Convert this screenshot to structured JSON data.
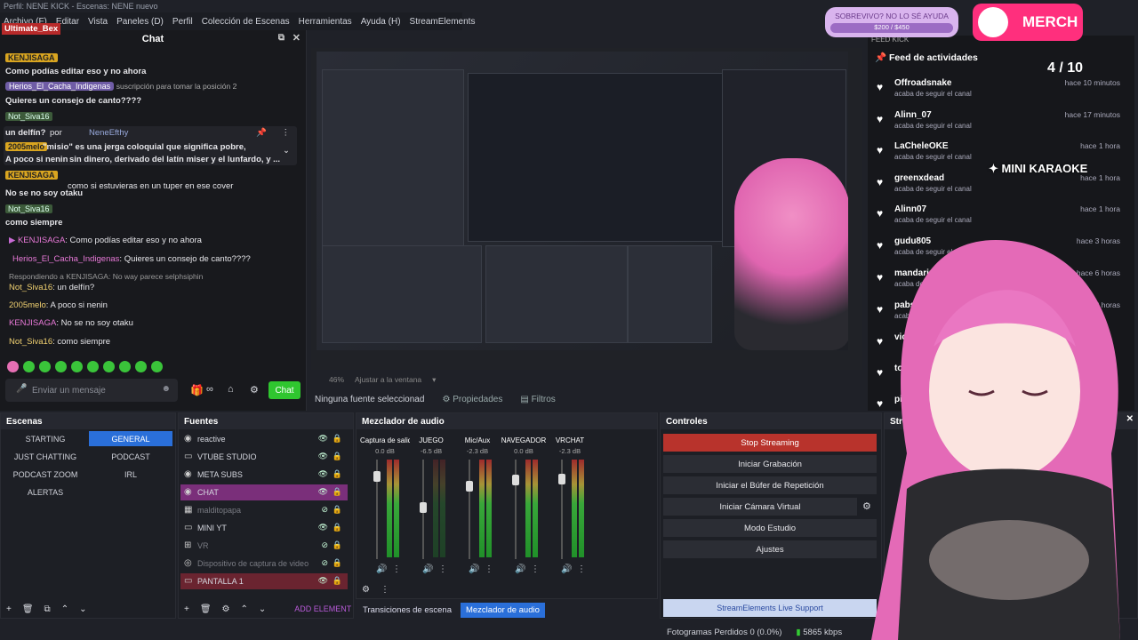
{
  "window": {
    "title": "Perfil: NENE KICK - Escenas: NENE nuevo"
  },
  "menu": [
    "Archivo (F)",
    "Editar",
    "Vista",
    "Paneles (D)",
    "Perfil",
    "Colección de Escenas",
    "Herramientas",
    "Ayuda (H)",
    "StreamElements"
  ],
  "chat": {
    "title": "Chat",
    "overlay_user": "Ultimate_Bex",
    "pinned_by_label": "un delfín?",
    "pinned_by": "por",
    "pinned_user": "NeneEfthy",
    "sub_note": "suscripción para tomar la posición 2",
    "lines": [
      {
        "user": "KENJISAGA",
        "text": "Como podías editar eso y no ahora"
      },
      {
        "user": "Herios_El_Cacha_Indigenas",
        "text": "Quieres un consejo de canto????"
      },
      {
        "user": "Not_Siva16",
        "text": ""
      },
      {
        "user": "2005melo",
        "text": "\"misio\" es una jerga coloquial que significa pobre,"
      },
      {
        "user": "",
        "text": "A poco si nenin"
      },
      {
        "user": "",
        "text": "sin dinero, derivado del latín miser y el lunfardo, y ..."
      },
      {
        "user": "KENJISAGA",
        "text": "como si estuvieras en un tuper en ese cover"
      },
      {
        "user": "",
        "text": "No se no soy otaku"
      },
      {
        "user": "Not_Siva16",
        "text": "como siempre"
      }
    ],
    "recent": [
      {
        "user": "KENJISAGA",
        "text": ": Como podías editar eso y no ahora"
      },
      {
        "user": "Herios_El_Cacha_Indigenas",
        "text": ": Quieres un consejo de canto????"
      },
      {
        "user": "",
        "text": "Respondiendo a KENJISAGA: No way parece selphsiphin"
      },
      {
        "user": "Not_Siva16",
        "text": ": un delfín?"
      },
      {
        "user": "2005melo",
        "text": ": A poco si nenin"
      },
      {
        "user": "KENJISAGA",
        "text": ": No se no soy otaku"
      },
      {
        "user": "Not_Siva16",
        "text": ": como siempre"
      }
    ],
    "input_placeholder": "Enviar un mensaje",
    "send_label": "Chat"
  },
  "preview": {
    "zoom": "46%",
    "fit_label": "Ajustar a la ventana"
  },
  "source_bar": {
    "none": "Ninguna fuente seleccionad",
    "properties": "Propiedades",
    "filters": "Filtros"
  },
  "feed": {
    "dock_title": "FEED KICK",
    "title": "Feed de actividades",
    "items": [
      {
        "name": "Offroadsnake",
        "action": "acaba de seguir el canal",
        "time": "hace 10 minutos"
      },
      {
        "name": "Alinn_07",
        "action": "acaba de seguir el canal",
        "time": "hace 17 minutos"
      },
      {
        "name": "LaCheleOKE",
        "action": "acaba de seguir el canal",
        "time": "hace 1 hora"
      },
      {
        "name": "greenxdead",
        "action": "acaba de seguir el canal",
        "time": "hace 1 hora"
      },
      {
        "name": "Alinn07",
        "action": "acaba de seguir el canal",
        "time": "hace 1 hora"
      },
      {
        "name": "gudu805",
        "action": "acaba de seguir el canal",
        "time": "hace 3 horas"
      },
      {
        "name": "mandarinat",
        "action": "acaba de seguir el canal",
        "time": "hace 6 horas"
      },
      {
        "name": "pabs75",
        "action": "acaba de seguir el canal",
        "time": "12 horas"
      },
      {
        "name": "victoroski",
        "action": "",
        "time": ""
      },
      {
        "name": "tomitoki",
        "action": "",
        "time": ""
      },
      {
        "name": "pierntony",
        "action": "",
        "time": ""
      }
    ]
  },
  "overlay": {
    "merch": "MERCH",
    "goal_text": "SOBREVIVO? NO LO SÉ AYUDA",
    "goal_amount": "$200 / $450",
    "counter": "4 / 10",
    "karaoke": "✦ MINI KARAOKE"
  },
  "scenes": {
    "title": "Escenas",
    "items": [
      {
        "label": "STARTING",
        "selected": false
      },
      {
        "label": "GENERAL",
        "selected": true
      },
      {
        "label": "JUST CHATTING",
        "selected": false
      },
      {
        "label": "PODCAST",
        "selected": false
      },
      {
        "label": "PODCAST ZOOM",
        "selected": false
      },
      {
        "label": "IRL",
        "selected": false
      },
      {
        "label": "ALERTAS",
        "selected": false
      }
    ]
  },
  "sources": {
    "title": "Fuentes",
    "items": [
      {
        "label": "reactive",
        "state": "normal"
      },
      {
        "label": "VTUBE STUDIO",
        "state": "normal"
      },
      {
        "label": "META SUBS",
        "state": "normal"
      },
      {
        "label": "CHAT",
        "state": "selected"
      },
      {
        "label": "malditopapa",
        "state": "dim"
      },
      {
        "label": "MINI YT",
        "state": "normal"
      },
      {
        "label": "VR",
        "state": "dim"
      },
      {
        "label": "Dispositivo de captura de video",
        "state": "dim"
      },
      {
        "label": "PANTALLA 1",
        "state": "red"
      }
    ],
    "add_element": "ADD ELEMENT"
  },
  "mixer": {
    "title": "Mezclador de audio",
    "channels": [
      {
        "name": "Captura de salida c",
        "db": "0.0 dB",
        "level": 0.78
      },
      {
        "name": "JUEGO",
        "db": "-6.5 dB",
        "level": 0.0
      },
      {
        "name": "Mic/Aux",
        "db": "-2.3 dB",
        "level": 0.6
      },
      {
        "name": "NAVEGADOR",
        "db": "0.0 dB",
        "level": 0.72
      },
      {
        "name": "VRCHAT",
        "db": "-2.3 dB",
        "level": 0.74
      }
    ],
    "scale": [
      "0",
      "-5",
      "-10",
      "-15",
      "-20",
      "-25",
      "-30",
      "-35",
      "-40",
      "-45",
      "-50",
      "-55",
      "-60"
    ]
  },
  "controls": {
    "title": "Controles",
    "items": [
      "Stop Streaming",
      "Iniciar Grabación",
      "Iniciar el Búfer de Repetición",
      "Iniciar Cámara Virtual",
      "Modo Estudio",
      "Ajustes"
    ],
    "support": "StreamElements Live Support"
  },
  "streamelements_dock": {
    "title": "StreamElem"
  },
  "bottom_tabs": [
    "Transiciones de escena",
    "Mezclador de audio"
  ],
  "status": {
    "dropped": "Fotogramas Perdidos 0 (0.0%)",
    "bitrate": "5865 kbps"
  }
}
